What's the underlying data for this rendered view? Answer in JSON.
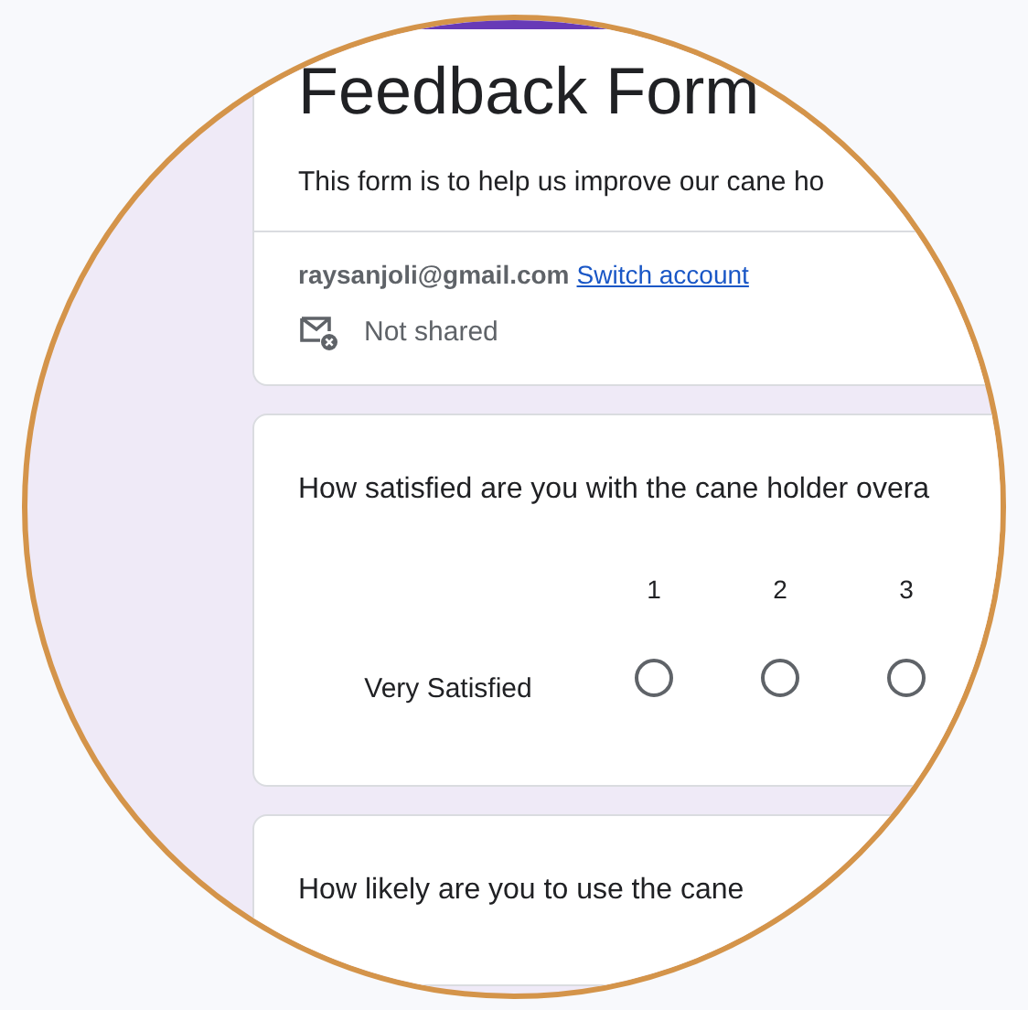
{
  "form": {
    "title": "Feedback Form",
    "description": "This form is to help us improve our cane ho",
    "account": {
      "email": "raysanjoli@gmail.com",
      "switch_link": "Switch account",
      "sharing": "Not shared"
    }
  },
  "questions": [
    {
      "kind": "grid",
      "text": "How satisfied are you with the cane holder overa",
      "columns": [
        "1",
        "2",
        "3"
      ],
      "rows": [
        {
          "label": "Very Satisfied",
          "choices": [
            {
              "selected": false
            },
            {
              "selected": false
            },
            {
              "selected": false
            }
          ]
        }
      ]
    },
    {
      "kind": "plain",
      "text": "How likely are you to use the cane"
    }
  ]
}
